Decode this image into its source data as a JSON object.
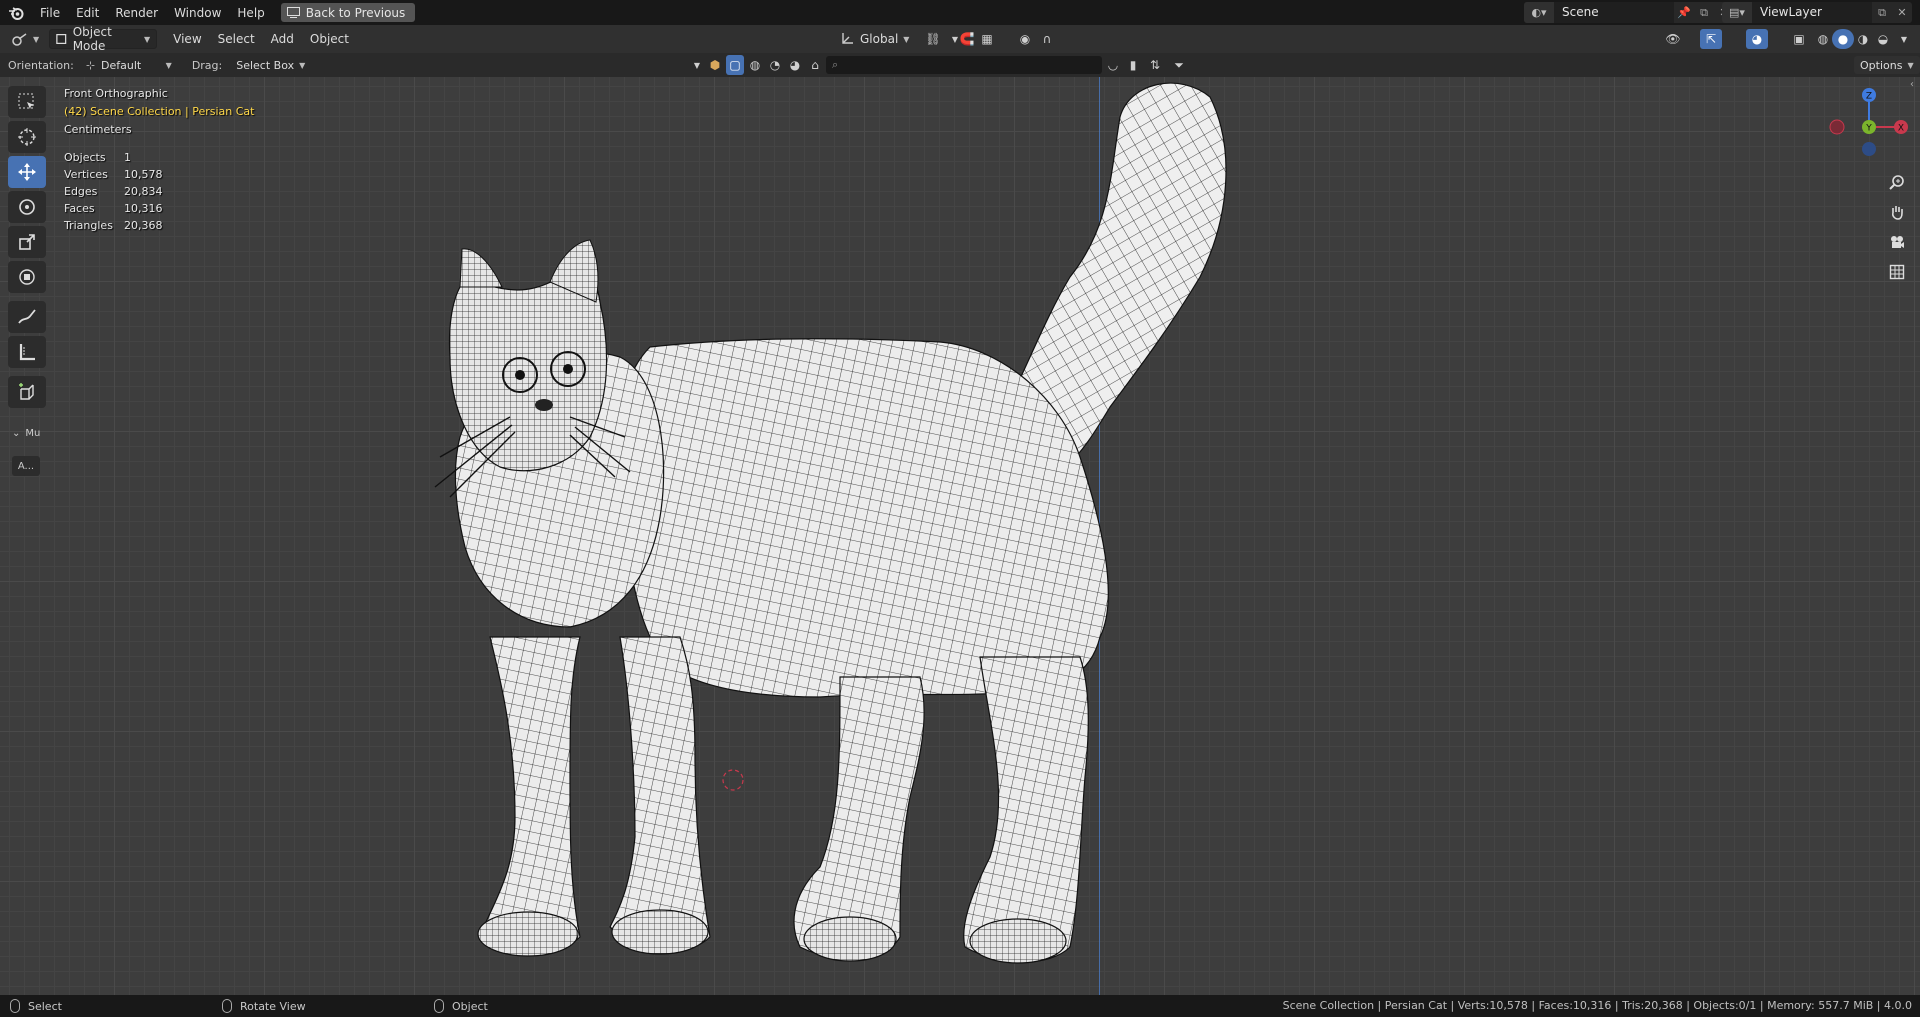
{
  "topbar": {
    "menus": [
      "File",
      "Edit",
      "Render",
      "Window",
      "Help"
    ],
    "back_button": "Back to Previous",
    "scene": "Scene",
    "view_layer": "ViewLayer"
  },
  "header": {
    "mode": "Object Mode",
    "menus": [
      "View",
      "Select",
      "Add",
      "Object"
    ],
    "transform_orientation": "Global",
    "options": "Options"
  },
  "tool_settings": {
    "orientation_label": "Orientation:",
    "orientation_value": "Default",
    "drag_label": "Drag:",
    "drag_value": "Select Box"
  },
  "viewport": {
    "view_name": "Front Orthographic",
    "collection_info": "(42) Scene Collection | Persian Cat",
    "units": "Centimeters",
    "stats": [
      {
        "label": "Objects",
        "value": "1"
      },
      {
        "label": "Vertices",
        "value": "10,578"
      },
      {
        "label": "Edges",
        "value": "20,834"
      },
      {
        "label": "Faces",
        "value": "10,316"
      },
      {
        "label": "Triangles",
        "value": "20,368"
      }
    ],
    "panel_label": "Mu",
    "panel_button": "A...",
    "gizmo_axes": {
      "z": "Z",
      "y": "Y",
      "x": "X"
    },
    "colors": {
      "x_axis": "#c8394d",
      "y_axis": "#7bb52c",
      "z_axis": "#3f7be0",
      "active_tool": "#4772b3",
      "collection_text": "#ffd84a"
    }
  },
  "statusbar": {
    "left": [
      {
        "icon": "mouse-left-icon",
        "label": "Select"
      },
      {
        "icon": "mouse-middle-icon",
        "label": "Rotate View"
      },
      {
        "icon": "mouse-right-icon",
        "label": "Object"
      }
    ],
    "right": "Scene Collection | Persian Cat | Verts:10,578 | Faces:10,316 | Tris:20,368 | Objects:0/1 | Memory: 557.7 MiB | 4.0.0"
  }
}
